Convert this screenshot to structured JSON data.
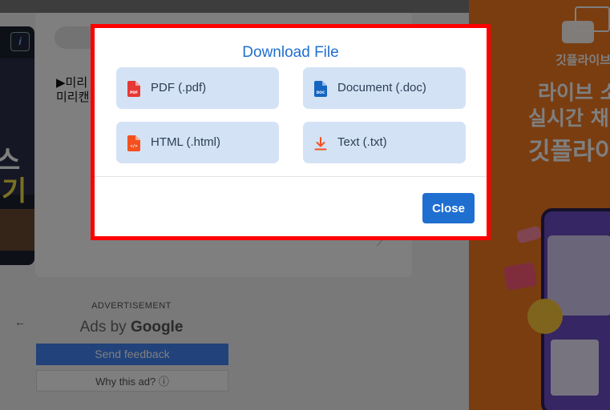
{
  "background": {
    "editor_text": "▶미리\n미리캔",
    "left_ad_info": "i",
    "left_ad_line1": "스",
    "left_ad_line2": "기",
    "ads": {
      "back_arrow": "←",
      "label": "ADVERTISEMENT",
      "ads_by_prefix": "Ads by ",
      "ads_by_brand": "Google",
      "feedback_label": "Send feedback",
      "why_label": "Why this ad? ⓘ"
    },
    "right_ad": {
      "brand": "깃플라이브",
      "line1": "라이브 소",
      "line2": "실시간 채",
      "line3": "깃플라이"
    }
  },
  "modal": {
    "title": "Download File",
    "options": [
      {
        "label": "PDF (.pdf)",
        "icon": "pdf-file-icon",
        "icon_text": "PDF",
        "color": "#e53935"
      },
      {
        "label": "Document (.doc)",
        "icon": "doc-file-icon",
        "icon_text": "DOC",
        "color": "#1565c0"
      },
      {
        "label": "HTML (.html)",
        "icon": "html-file-icon",
        "icon_text": "</>",
        "color": "#f4511e"
      },
      {
        "label": "Text (.txt)",
        "icon": "download-icon",
        "color": "#f4511e"
      }
    ],
    "close_label": "Close"
  },
  "colors": {
    "accent": "#1f6fd1",
    "option_bg": "#d4e2f6",
    "highlight_border": "#ff0000",
    "right_ad_bg": "#f57a20"
  }
}
